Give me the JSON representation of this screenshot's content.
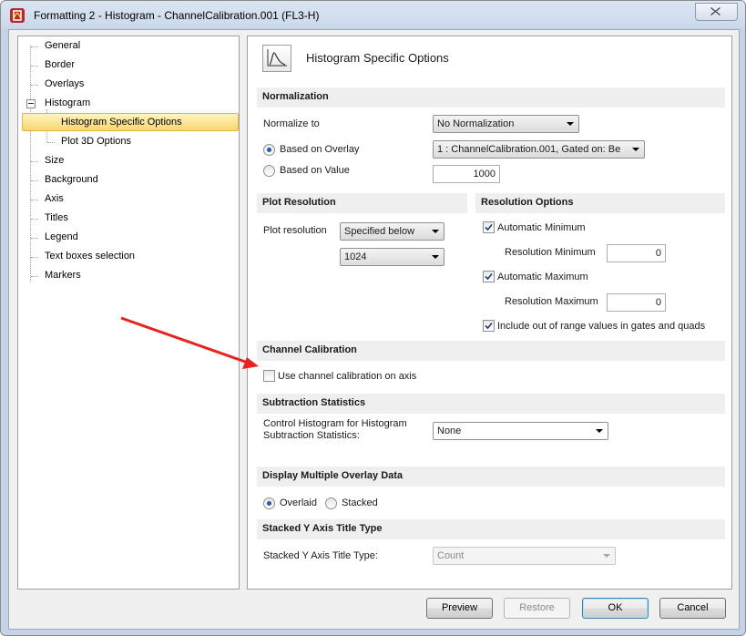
{
  "window": {
    "title": "Formatting 2 - Histogram - ChannelCalibration.001 (FL3-H)"
  },
  "nav": {
    "items": [
      {
        "label": "General"
      },
      {
        "label": "Border"
      },
      {
        "label": "Overlays"
      },
      {
        "label": "Histogram"
      },
      {
        "label": "Histogram Specific Options",
        "selected": true
      },
      {
        "label": "Plot 3D Options"
      },
      {
        "label": "Size"
      },
      {
        "label": "Background"
      },
      {
        "label": "Axis"
      },
      {
        "label": "Titles"
      },
      {
        "label": "Legend"
      },
      {
        "label": "Text boxes selection"
      },
      {
        "label": "Markers"
      }
    ]
  },
  "panel": {
    "title": "Histogram Specific Options",
    "icon": "histogram-icon"
  },
  "normalization": {
    "header": "Normalization",
    "normalize_to_label": "Normalize to",
    "normalize_to_value": "No Normalization",
    "based_on_overlay_label": "Based on Overlay",
    "based_on_overlay_checked": true,
    "overlay_value": "1 : ChannelCalibration.001, Gated on: Be",
    "based_on_value_label": "Based on Value",
    "based_on_value_checked": false,
    "value": "1000"
  },
  "plot_resolution": {
    "header": "Plot Resolution",
    "label": "Plot resolution",
    "mode_value": "Specified below",
    "resolution_value": "1024"
  },
  "resolution_options": {
    "header": "Resolution Options",
    "auto_min_label": "Automatic Minimum",
    "auto_min_checked": true,
    "res_min_label": "Resolution Minimum",
    "res_min_value": "0",
    "auto_max_label": "Automatic Maximum",
    "auto_max_checked": true,
    "res_max_label": "Resolution Maximum",
    "res_max_value": "0",
    "include_label": "Include out of range values in gates and quads",
    "include_checked": true
  },
  "channel_calibration": {
    "header": "Channel Calibration",
    "use_label": "Use channel calibration on axis",
    "use_checked": false
  },
  "subtraction": {
    "header": "Subtraction Statistics",
    "label_line1": "Control Histogram for Histogram",
    "label_line2": "Subtraction Statistics:",
    "value": "None"
  },
  "overlay_display": {
    "header": "Display Multiple Overlay Data",
    "overlaid_label": "Overlaid",
    "overlaid_checked": true,
    "stacked_label": "Stacked",
    "stacked_checked": false
  },
  "stacked_title": {
    "header": "Stacked Y Axis Title Type",
    "label": "Stacked Y Axis Title Type:",
    "value": "Count"
  },
  "buttons": {
    "preview": "Preview",
    "restore": "Restore",
    "ok": "OK",
    "cancel": "Cancel"
  },
  "colors": {
    "annotation_arrow": "#e8231f",
    "selection_fill": "#f8d76e",
    "radio_dot": "#2a5aa8"
  }
}
